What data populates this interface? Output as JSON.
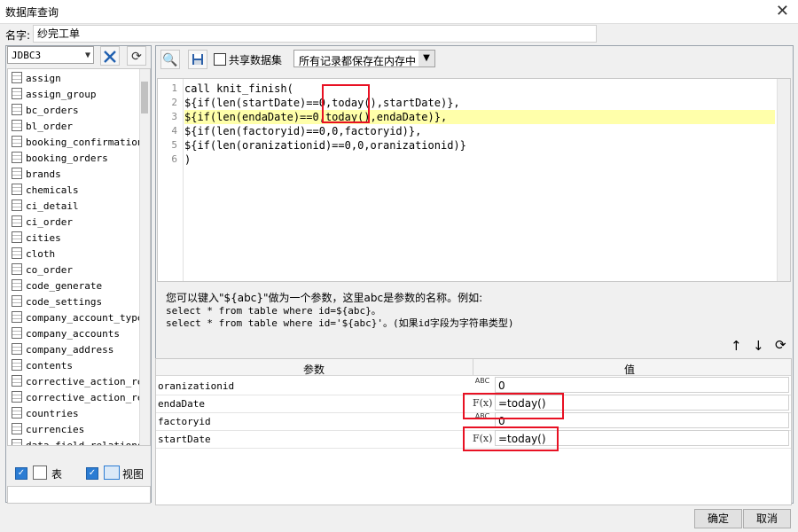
{
  "window": {
    "title": "数据库查询",
    "close_label": "✕"
  },
  "name_field": {
    "label": "名字:",
    "value": "纱完工单"
  },
  "left": {
    "db_combo": "JDBC3",
    "tables": [
      "assign",
      "assign_group",
      "bc_orders",
      "bl_order",
      "booking_confirmation",
      "booking_orders",
      "brands",
      "chemicals",
      "ci_detail",
      "ci_order",
      "cities",
      "cloth",
      "co_order",
      "code_generate",
      "code_settings",
      "company_account_types",
      "company_accounts",
      "company_address",
      "contents",
      "corrective_action_rep",
      "corrective_action_rep",
      "countries",
      "currencies",
      "data_field_relations"
    ],
    "check_table_label": "表",
    "check_view_label": "视图"
  },
  "toolbar": {
    "shared_label": "共享数据集",
    "mode_select": "所有记录都保存在内存中"
  },
  "editor": {
    "line_numbers": [
      "1",
      "2",
      "3",
      "4",
      "5",
      "6"
    ],
    "lines": [
      "call knit_finish(",
      "${if(len(startDate)==0,today(),startDate)},",
      "${if(len(endaDate)==0,today(),endaDate)},",
      "${if(len(factoryid)==0,0,factoryid)},",
      "${if(len(oranizationid)==0,0,oranizationid)}",
      ")"
    ]
  },
  "hint": {
    "line1": "您可以键入\"${abc}\"做为一个参数，这里abc是参数的名称。例如:",
    "line2": "select * from table where id=${abc}。",
    "line3": "select * from table where id='${abc}'。(如果id字段为字符串类型)"
  },
  "params": {
    "header_name": "参数",
    "header_value": "值",
    "rows": [
      {
        "name": "oranizationid",
        "type": "ABC",
        "value": "0"
      },
      {
        "name": "endaDate",
        "type": "F(x)",
        "value": "=today()"
      },
      {
        "name": "factoryid",
        "type": "ABC",
        "value": "0"
      },
      {
        "name": "startDate",
        "type": "F(x)",
        "value": "=today()"
      }
    ]
  },
  "buttons": {
    "ok": "确定",
    "cancel": "取消"
  },
  "colors": {
    "highlight": "#ffffaa",
    "annotation": "#e81123",
    "checkbox": "#2b7cd3"
  }
}
